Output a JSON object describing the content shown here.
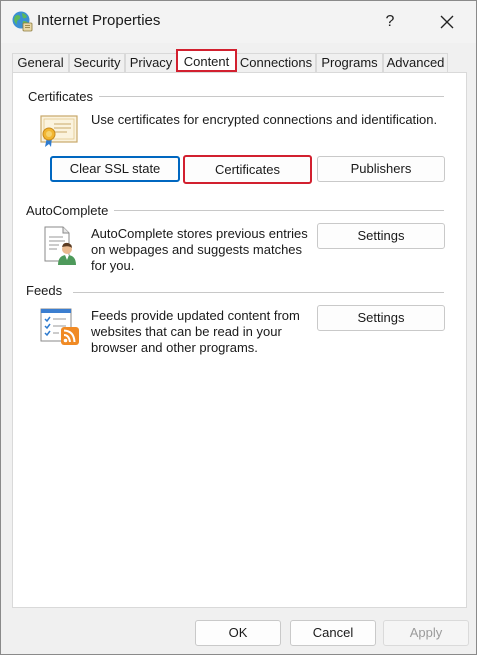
{
  "window": {
    "title": "Internet Properties",
    "help_label": "?",
    "icons": {
      "app": "internet-globe-icon",
      "close": "close-icon"
    }
  },
  "tabs": [
    {
      "label": "General"
    },
    {
      "label": "Security"
    },
    {
      "label": "Privacy"
    },
    {
      "label": "Content",
      "active": true
    },
    {
      "label": "Connections"
    },
    {
      "label": "Programs"
    },
    {
      "label": "Advanced"
    }
  ],
  "certificates": {
    "heading": "Certificates",
    "description": "Use certificates for encrypted connections and identification.",
    "icon": "certificate-icon",
    "buttons": {
      "clear_ssl": "Clear SSL state",
      "certificates": "Certificates",
      "publishers": "Publishers"
    }
  },
  "autocomplete": {
    "heading": "AutoComplete",
    "description_lines": [
      "AutoComplete stores previous entries",
      "on webpages and suggests matches",
      "for you."
    ],
    "icon": "autocomplete-document-user-icon",
    "settings_label": "Settings"
  },
  "feeds": {
    "heading": "Feeds",
    "description_lines": [
      "Feeds provide updated content from",
      "websites that can be read in your",
      "browser and other programs."
    ],
    "icon": "feeds-rss-icon",
    "settings_label": "Settings"
  },
  "footer": {
    "ok": "OK",
    "cancel": "Cancel",
    "apply": "Apply"
  },
  "colors": {
    "highlight_red": "#d2202f",
    "focus_blue": "#0067c0"
  }
}
